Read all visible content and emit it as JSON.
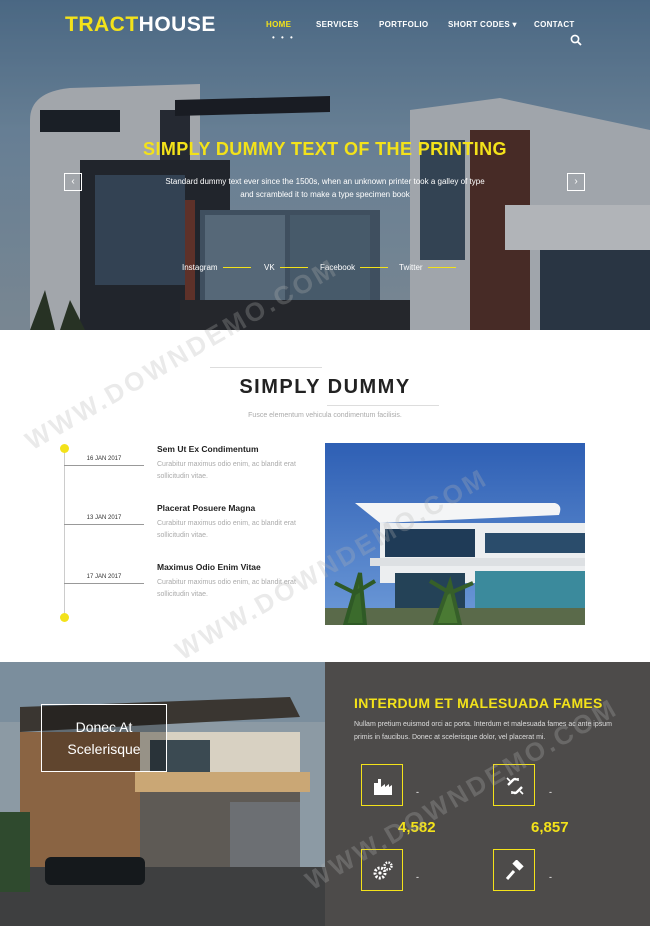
{
  "logo": {
    "part1": "TRACT",
    "part2": "HOUSE"
  },
  "nav": [
    {
      "label": "HOME",
      "active": true
    },
    {
      "label": "SERVICES",
      "active": false
    },
    {
      "label": "PORTFOLIO",
      "active": false
    },
    {
      "label": "SHORT CODES ▾",
      "active": false
    },
    {
      "label": "CONTACT",
      "active": false
    }
  ],
  "nav_dots": "• • •",
  "hero": {
    "title": "SIMPLY DUMMY TEXT OF THE PRINTING",
    "text": "Standard dummy text ever since the 1500s, when an unknown printer took a galley of type and scrambled it to make a type specimen book",
    "prev_arrow": "‹",
    "next_arrow": "›",
    "social": [
      "Instagram",
      "VK",
      "Facebook",
      "Twitter"
    ]
  },
  "section2": {
    "title": "SIMPLY DUMMY",
    "subtitle": "Fusce elementum vehicula condimentum facilisis.",
    "timeline": [
      {
        "date": "16 JAN 2017",
        "title": "Sem Ut Ex Condimentum",
        "text": "Curabitur maximus odio enim, ac blandit erat sollicitudin vitae."
      },
      {
        "date": "13 JAN 2017",
        "title": "Placerat Posuere Magna",
        "text": "Curabitur maximus odio enim, ac blandit erat sollicitudin vitae."
      },
      {
        "date": "17 JAN 2017",
        "title": "Maximus Odio Enim Vitae",
        "text": "Curabitur maximus odio enim, ac blandit erat sollicitudin vitae."
      }
    ]
  },
  "section3": {
    "box_line1": "Donec At",
    "box_line2": "Scelerisque",
    "title": "INTERDUM ET MALESUADA FAMES",
    "text": "Nullam pretium euismod orci ac porta. Interdum et malesuada fames ac ante ipsum primis in faucibus. Donec at scelerisque dolor, vel placerat mi.",
    "stats": [
      {
        "icon": "factory-icon",
        "dash": "-",
        "value": "4,582"
      },
      {
        "icon": "broken-link-icon",
        "dash": "-",
        "value": "6,857"
      },
      {
        "icon": "gears-icon",
        "dash": "-",
        "value": ""
      },
      {
        "icon": "gavel-icon",
        "dash": "-",
        "value": ""
      }
    ]
  },
  "watermark": "WWW.DOWNDEMO.COM",
  "colors": {
    "accent": "#f3e21a",
    "dark_panel": "#4d4b4a"
  }
}
